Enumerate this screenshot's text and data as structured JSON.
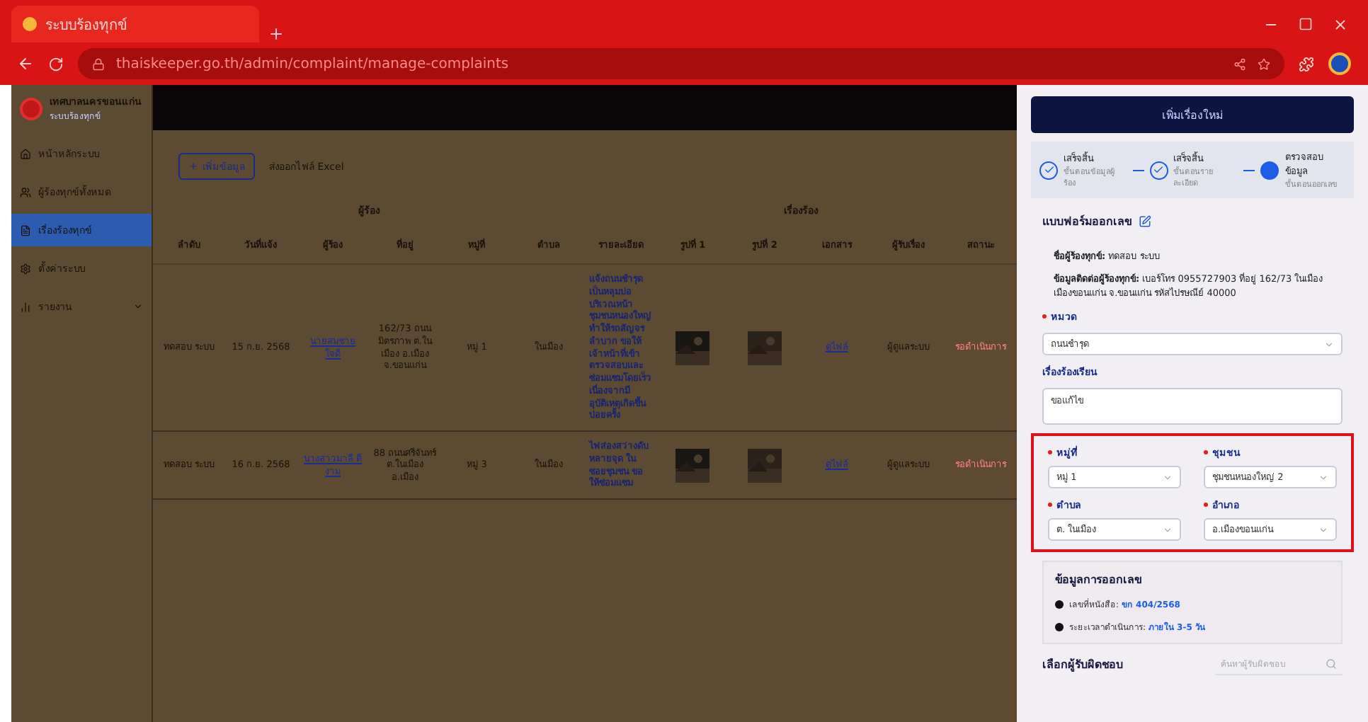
{
  "browser": {
    "tab_title": "ระบบร้องทุกข์",
    "url": "thaiskeeper.go.th/admin/complaint/manage-complaints"
  },
  "sidebar": {
    "title": "เทศบาลนครขอนแก่น",
    "subtitle": "ระบบร้องทุกข์",
    "items": [
      {
        "label": "หน้าหลักระบบ",
        "selected": false
      },
      {
        "label": "ผู้ร้องทุกข์ทั้งหมด",
        "selected": false
      },
      {
        "label": "เรื่องร้องทุกข์",
        "selected": true
      },
      {
        "label": "ตั้งค่าระบบ",
        "selected": false
      },
      {
        "label": "รายงาน",
        "selected": false,
        "expanded": false
      }
    ]
  },
  "toolbar": {
    "add_button": "เพิ่มข้อมูล",
    "export_link": "ส่งออกไฟล์ Excel"
  },
  "table": {
    "groups": [
      "ผู้ร้อง",
      "เรื่องร้อง"
    ],
    "columns": [
      "ลำดับ",
      "วันที่แจ้ง",
      "ผู้ร้อง",
      "ที่อยู่",
      "หมู่ที่",
      "ตำบล",
      "รายละเอียด",
      "รูปที่ 1",
      "รูปที่ 2",
      "เอกสาร",
      "ผู้รับเรื่อง",
      "สถานะ"
    ],
    "rows": [
      {
        "cells": [
          "ทดสอบ ระบบ",
          "15 ก.ย. 2568",
          "นายสมชาย ใจดี",
          "162/73 ถนนมิตรภาพ ต.ในเมือง อ.เมือง จ.ขอนแก่น",
          "หมู่ 1",
          "ในเมือง",
          "แจ้งถนนชำรุดเป็นหลุมบ่อ บริเวณหน้าชุมชนหนองใหญ่ ทำให้รถสัญจรลำบาก ขอให้เจ้าหน้าที่เข้าตรวจสอบและซ่อมแซมโดยเร็ว เนื่องจากมีอุบัติเหตุเกิดขึ้นบ่อยครั้ง",
          "",
          "",
          "ดูไฟล์",
          "ผู้ดูแลระบบ",
          "รอดำเนินการ"
        ]
      },
      {
        "cells": [
          "ทดสอบ ระบบ",
          "16 ก.ย. 2568",
          "นางสาวมาลี ดีงาม",
          "88 ถนนศรีจันทร์ ต.ในเมือง อ.เมือง",
          "หมู่ 3",
          "ในเมือง",
          "ไฟส่องสว่างดับหลายจุด ในซอยชุมชน ขอให้ซ่อมแซม",
          "",
          "",
          "ดูไฟล์",
          "ผู้ดูแลระบบ",
          "รอดำเนินการ"
        ]
      }
    ]
  },
  "drawer": {
    "top_button": "เพิ่มเรื่องใหม่",
    "steps": [
      {
        "title": "เสร็จสิ้น",
        "subtitle": "ขั้นตอนข้อมูลผู้ร้อง",
        "done": true
      },
      {
        "title": "เสร็จสิ้น",
        "subtitle": "ขั้นตอนรายละเอียด",
        "done": true
      },
      {
        "title": "ตรวจสอบข้อมูล",
        "subtitle": "ขั้นตอนออกเลข",
        "done": false
      }
    ],
    "form_title": "แบบฟอร์มออกเลข",
    "info": [
      {
        "label": "ชื่อผู้ร้องทุกข์:",
        "value": "ทดสอบ ระบบ"
      },
      {
        "label": "ข้อมูลติดต่อผู้ร้องทุกข์:",
        "value": "เบอร์โทร 0955727903 ที่อยู่ 162/73 ในเมือง เมืองขอนแก่น จ.ขอนแก่น รหัสไปรษณีย์ 40000"
      }
    ],
    "category": {
      "label": "หมวด",
      "required": true,
      "value": "ถนนชำรุด"
    },
    "subject": {
      "label": "เรื่องร้องเรียน",
      "value": "ขอแก้ไข"
    },
    "location_fields": [
      {
        "label": "หมู่ที่",
        "required": true,
        "value": "หมู่ 1"
      },
      {
        "label": "ชุมชน",
        "required": true,
        "value": "ชุมชนหนองใหญ่ 2"
      },
      {
        "label": "ตำบล",
        "required": true,
        "value": "ต. ในเมือง"
      },
      {
        "label": "อำเภอ",
        "required": true,
        "value": "อ.เมืองขอนแก่น"
      }
    ],
    "number_box": {
      "title": "ข้อมูลการออกเลข",
      "items": [
        {
          "label": "เลขที่หนังสือ:",
          "value": "ขก 404/2568"
        },
        {
          "label": "ระยะเวลาดำเนินการ:",
          "value": "ภายใน 3-5 วัน"
        }
      ]
    },
    "assignee": {
      "label": "เลือกผู้รับผิดชอบ",
      "placeholder": "ค้นหาผู้รับผิดชอบ"
    }
  }
}
